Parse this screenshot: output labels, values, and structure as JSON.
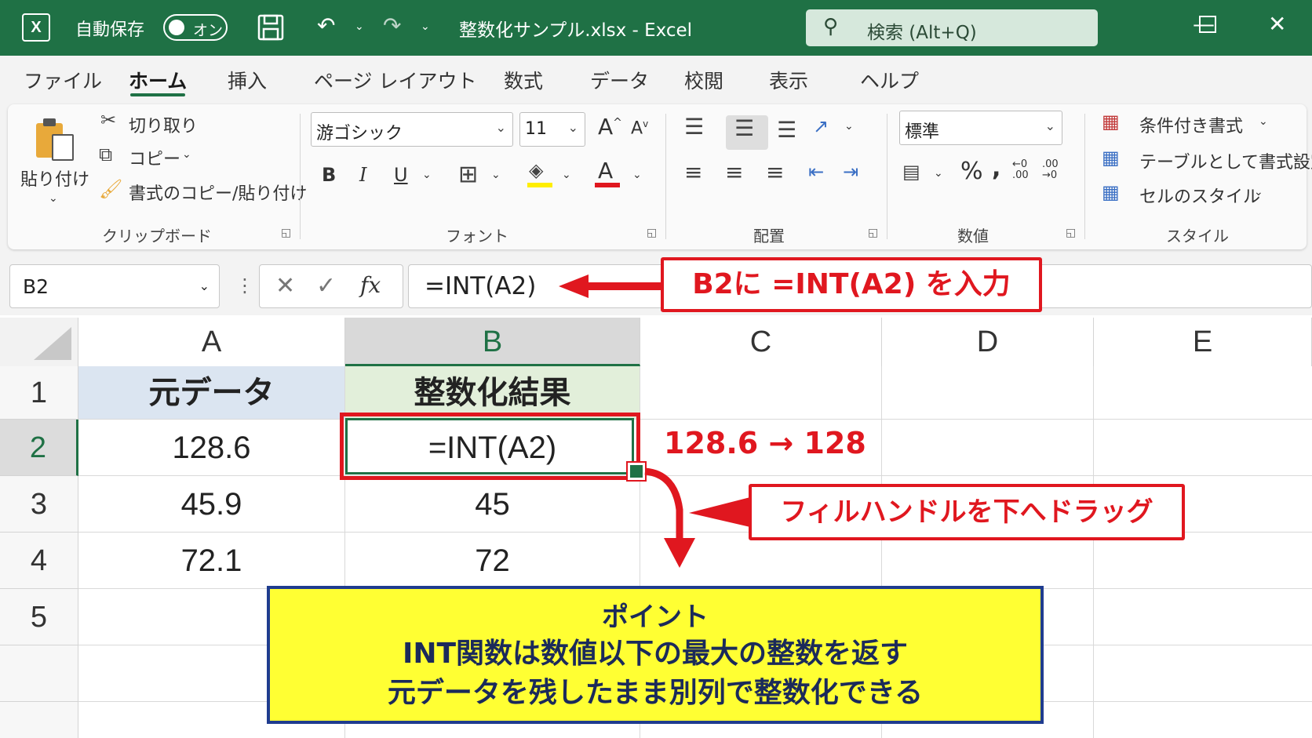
{
  "titlebar": {
    "logo": "X",
    "autosave_label": "自動保存",
    "autosave_state": "オン",
    "doc_title": "整数化サンプル.xlsx  -  Excel",
    "search_placeholder": "検索 (Alt+Q)"
  },
  "menu": {
    "tabs": [
      "ファイル",
      "ホーム",
      "挿入",
      "ページ レイアウト",
      "数式",
      "データ",
      "校閲",
      "表示",
      "ヘルプ"
    ],
    "active_tab": "ホーム"
  },
  "ribbon": {
    "clipboard": {
      "paste": "貼り付け",
      "cut": "切り取り",
      "copy": "コピー",
      "format_painter": "書式のコピー/貼り付け",
      "group_label": "クリップボード"
    },
    "font": {
      "font_name": "游ゴシック",
      "font_size": "11",
      "bold": "B",
      "italic": "I",
      "underline": "U",
      "group_label": "フォント"
    },
    "alignment": {
      "group_label": "配置"
    },
    "number": {
      "format": "標準",
      "percent": "%",
      "comma": ",",
      "group_label": "数値"
    },
    "styles": {
      "conditional": "条件付き書式",
      "as_table": "テーブルとして書式設定",
      "cell_styles": "セルのスタイル",
      "group_label": "スタイル"
    }
  },
  "formula_bar": {
    "name_box": "B2",
    "formula": "=INT(A2)",
    "fx": "fx"
  },
  "sheet": {
    "columns": [
      "A",
      "B",
      "C",
      "D",
      "E"
    ],
    "selected_column": "B",
    "rows": [
      "1",
      "2",
      "3",
      "4",
      "5"
    ],
    "selected_row": "2",
    "cells": {
      "A1": "元データ",
      "B1": "整数化結果",
      "A2": "128.6",
      "B2": "=INT(A2)",
      "A3": "45.9",
      "B3": "45",
      "A4": "72.1",
      "B4": "72"
    }
  },
  "annotations": {
    "formula_callout": "B2に =INT(A2) を入力",
    "result_note": "128.6 → 128",
    "fill_callout": "フィルハンドルを下へドラッグ",
    "point_title": "ポイント",
    "point_line1": "INT関数は数値以下の最大の整数を返す",
    "point_line2": "元データを残したまま別列で整数化できる"
  },
  "colors": {
    "excel_green": "#1f7145",
    "annotation_red": "#e0171f",
    "note_yellow": "#ffff33",
    "note_border": "#1f3c8f",
    "header_a_fill": "#dbe5f1",
    "header_b_fill": "#e2efda"
  }
}
